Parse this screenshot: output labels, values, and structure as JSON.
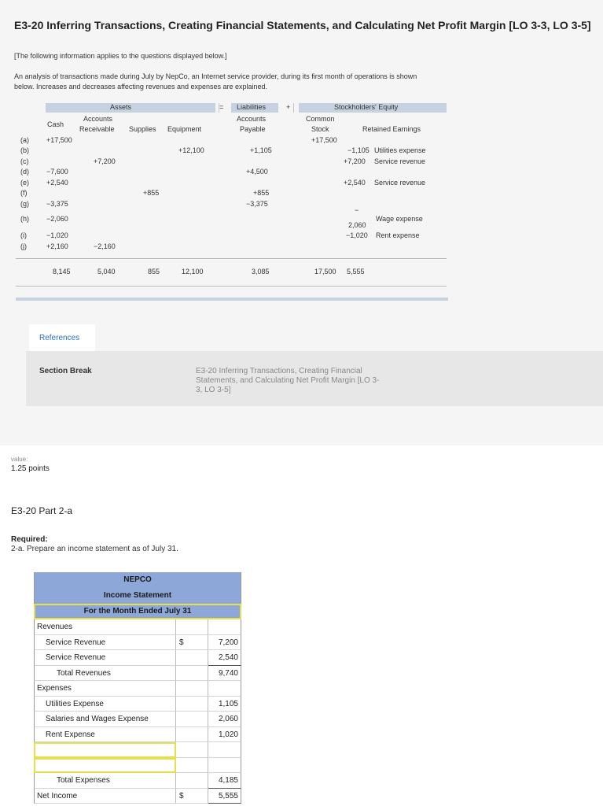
{
  "title": "E3-20 Inferring Transactions, Creating Financial Statements, and Calculating Net Profit Margin [LO 3-3, LO 3-5]",
  "note": "[The following information applies to the questions displayed below.]",
  "intro": "An analysis of transactions made during July by NepCo, an Internet service provider, during its first month of operations is shown below. Increases and decreases affecting revenues and expenses are explained.",
  "analysis": {
    "headers": {
      "assets": "Assets",
      "equals": "=",
      "liabilities": "Liabilities",
      "plus": "+",
      "equity": "Stockholders' Equity",
      "cash": "Cash",
      "ar1": "Accounts",
      "ar2": "Receivable",
      "supplies": "Supplies",
      "equipment": "Equipment",
      "ap1": "Accounts",
      "ap2": "Payable",
      "cs1": "Common",
      "cs2": "Stock",
      "re": "Retained Earnings"
    },
    "rows": [
      {
        "label": "(a)",
        "cash": "+17,500",
        "ar": "",
        "supplies": "",
        "equipment": "",
        "ap": "",
        "cs": "+17,500",
        "re": "",
        "re_desc": ""
      },
      {
        "label": "(b)",
        "cash": "",
        "ar": "",
        "supplies": "",
        "equipment": "",
        "ap": "+1,105",
        "cs": "",
        "re": "−1,105",
        "re_desc": "Utilities expense"
      },
      {
        "label": "(c)",
        "cash": "",
        "ar": "+7,200",
        "supplies": "",
        "equipment": "",
        "ap": "",
        "cs": "",
        "re": "+7,200",
        "re_desc": "Service revenue"
      },
      {
        "label": "(d)",
        "cash": "−7,600",
        "ar": "",
        "supplies": "",
        "equipment": "+12,100",
        "ap": "+4,500",
        "cs": "",
        "re": "",
        "re_desc": ""
      },
      {
        "label": "(e)",
        "cash": "+2,540",
        "ar": "",
        "supplies": "",
        "equipment": "",
        "ap": "",
        "cs": "",
        "re": "+2,540",
        "re_desc": "Service revenue"
      },
      {
        "label": "(f)",
        "cash": "",
        "ar": "",
        "supplies": "+855",
        "equipment": "",
        "ap": "+855",
        "cs": "",
        "re": "",
        "re_desc": ""
      },
      {
        "label": "(g)",
        "cash": "−3,375",
        "ar": "",
        "supplies": "",
        "equipment": "",
        "ap": "−3,375",
        "cs": "",
        "re": "",
        "re_desc": ""
      },
      {
        "label": "(h)",
        "cash": "−2,060",
        "ar": "",
        "supplies": "",
        "equipment": "",
        "ap": "",
        "cs": "",
        "re": "2,060",
        "re_desc": "Wage expense"
      },
      {
        "label": "(i)",
        "cash": "−1,020",
        "ar": "",
        "supplies": "",
        "equipment": "",
        "ap": "",
        "cs": "",
        "re": "−1,020",
        "re_desc": "Rent expense"
      },
      {
        "label": "(j)",
        "cash": "+2,160",
        "ar": "−2,160",
        "supplies": "",
        "equipment": "",
        "ap": "",
        "cs": "",
        "re": "",
        "re_desc": ""
      }
    ],
    "wage_dash": "−",
    "totals": {
      "cash": "8,145",
      "ar": "5,040",
      "supplies": "855",
      "equipment": "12,100",
      "ap": "3,085",
      "cs": "17,500",
      "re": "5,555"
    }
  },
  "references_label": "References",
  "section_break": {
    "label": "Section Break",
    "text": "E3-20 Inferring Transactions, Creating Financial Statements, and Calculating Net Profit Margin [LO 3-3, LO 3-5]"
  },
  "value_label": "value:",
  "points": "1.25 points",
  "part_title": "E3-20 Part 2-a",
  "required_label": "Required:",
  "required_text": "2-a.  Prepare an income statement as of July 31.",
  "income_statement": {
    "company": "NEPCO",
    "statement": "Income Statement",
    "period": "For the Month Ended July 31",
    "revenues_label": "Revenues",
    "revenues": [
      {
        "name": "Service Revenue",
        "sym": "$",
        "amount": "7,200"
      },
      {
        "name": "Service Revenue",
        "sym": "",
        "amount": "2,540"
      }
    ],
    "total_revenues_label": "Total Revenues",
    "total_revenues": "9,740",
    "expenses_label": "Expenses",
    "expenses": [
      {
        "name": "Utilities Expense",
        "amount": "1,105"
      },
      {
        "name": "Salaries and Wages Expense",
        "amount": "2,060"
      },
      {
        "name": "Rent Expense",
        "amount": "1,020"
      }
    ],
    "total_expenses_label": "Total Expenses",
    "total_expenses": "4,185",
    "net_income_label": "Net Income",
    "net_income_sym": "$",
    "net_income": "5,555"
  }
}
